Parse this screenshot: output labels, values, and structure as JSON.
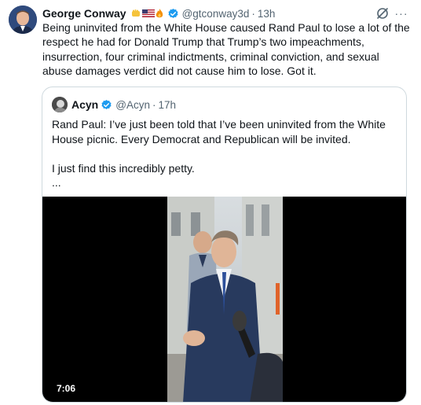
{
  "post": {
    "author_name": "George Conway",
    "author_emojis": [
      "fist-icon",
      "us-flag-icon",
      "fire-icon"
    ],
    "author_handle": "@gtconway3d",
    "separator": "·",
    "timestamp": "13h",
    "more_label": "···",
    "text": "Being uninvited from the White House caused Rand Paul to lose a lot of the respect he had for Donald Trump that Trump’s two impeachments, insurrection, four criminal indictments, criminal conviction, and sexual abuse damages verdict did not cause him to lose.  Got it."
  },
  "quoted_post": {
    "author_name": "Acyn",
    "author_handle": "@Acyn",
    "separator": "·",
    "timestamp": "17h",
    "line1": "Rand Paul: I’ve just been told that I’ve been uninvited from the White House picnic. Every Democrat and Republican will be invited.",
    "line2": "I just find this incredibly petty.",
    "line3": "...",
    "video_duration": "7:06"
  },
  "colors": {
    "verified_blue": "#1d9bf0",
    "secondary_text": "#536471",
    "border": "#cfd9de"
  }
}
